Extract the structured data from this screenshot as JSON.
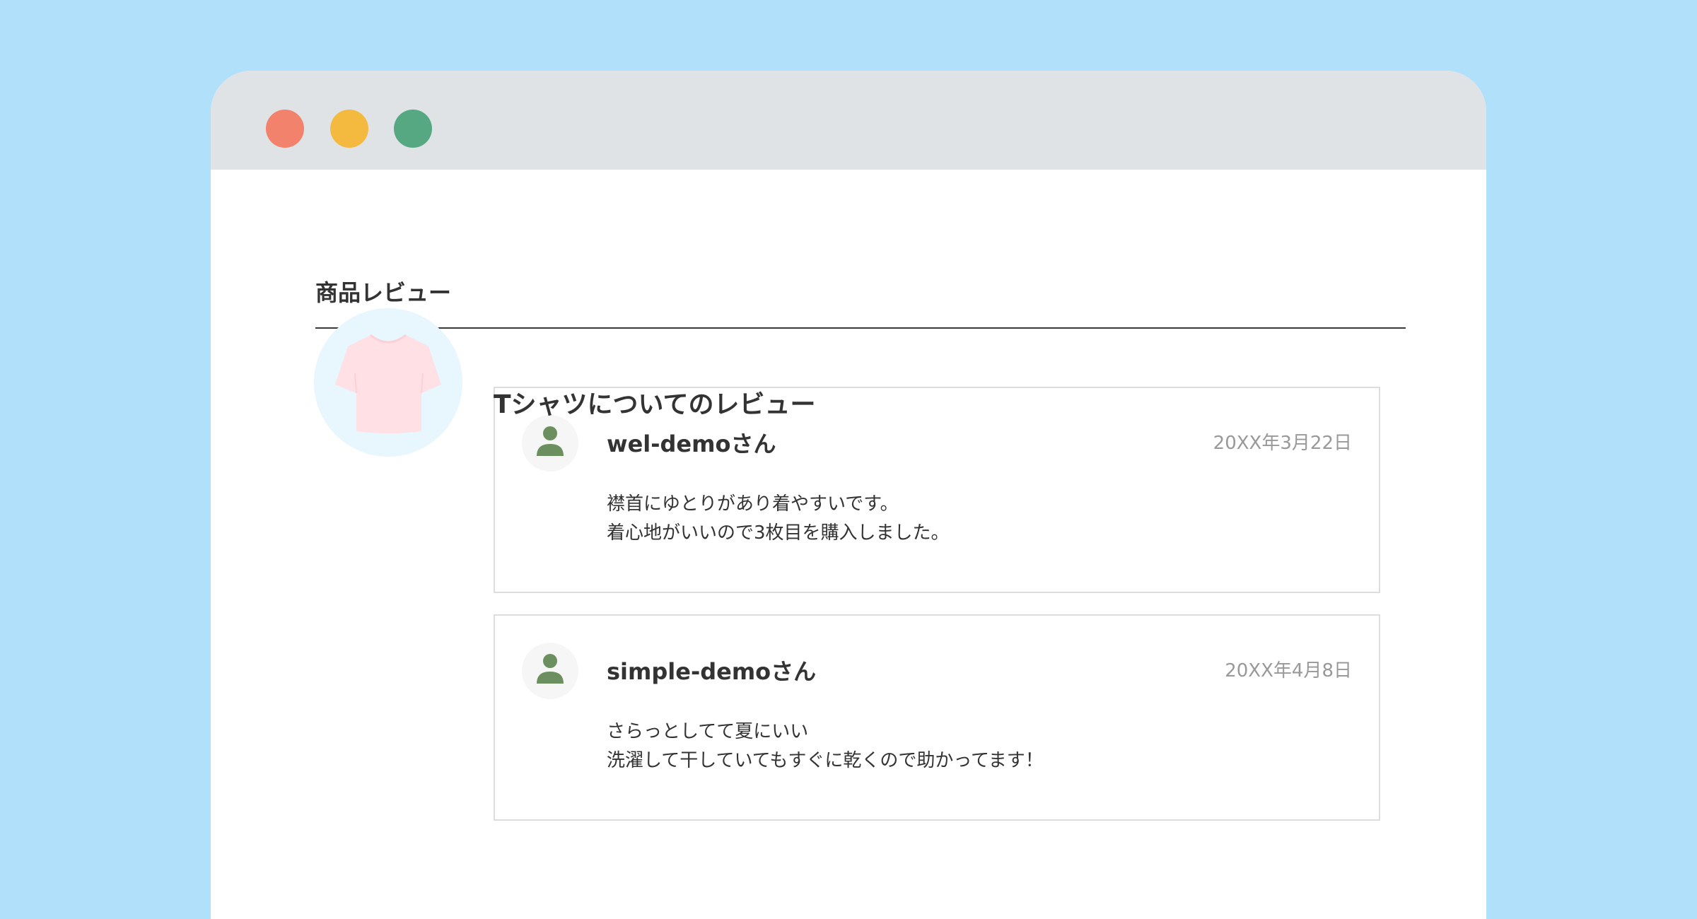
{
  "window": {
    "controls": [
      "close",
      "minimize",
      "maximize"
    ],
    "colors": {
      "background": "#b1e0fb",
      "titlebar": "#e0e3e6",
      "close": "#f2826c",
      "minimize": "#f4ba40",
      "maximize": "#55a882"
    }
  },
  "page": {
    "section_title": "商品レビュー"
  },
  "product": {
    "icon": "t-shirt-icon",
    "thumb_color": "#e8f6fe",
    "shirt_color": "#ffe0e4",
    "review_heading": "Tシャツについてのレビュー"
  },
  "reviews": [
    {
      "avatar_icon": "user-icon",
      "name": "wel-demoさん",
      "date": "20XX年3月22日",
      "lines": [
        "襟首にゆとりがあり着やすいです。",
        "着心地がいいので3枚目を購入しました。"
      ]
    },
    {
      "avatar_icon": "user-icon",
      "name": "simple-demoさん",
      "date": "20XX年4月8日",
      "lines": [
        "さらっとしてて夏にいい",
        "洗濯して干していてもすぐに乾くので助かってます！"
      ]
    }
  ]
}
